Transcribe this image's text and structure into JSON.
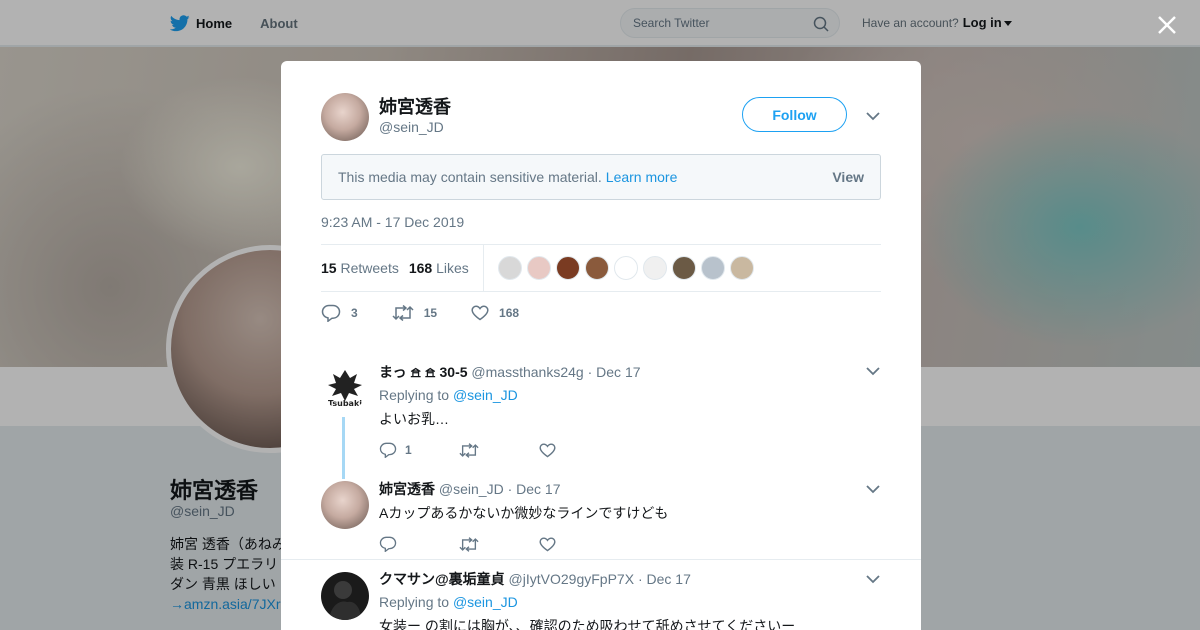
{
  "nav": {
    "home_label": "Home",
    "about_label": "About",
    "search_placeholder": "Search Twitter",
    "account_prompt": "Have an account?",
    "login_label": "Log in"
  },
  "profile": {
    "name": "姉宮透香",
    "handle": "@sein_JD",
    "bio_line1": "姉宮 透香（あねみ",
    "bio_line2": "装 R-15 プエラリ",
    "bio_line3": "ダン 青黒 ほしい",
    "bio_link": "→amzn.asia/7JXr"
  },
  "tweet": {
    "name": "姉宮透香",
    "handle": "@sein_JD",
    "follow_label": "Follow",
    "sensitive_text": "This media may contain sensitive material.",
    "learn_more": "Learn more",
    "view_label": "View",
    "timestamp": "9:23 AM - 17 Dec 2019",
    "retweets_count": "15",
    "retweets_label": "Retweets",
    "likes_count": "168",
    "likes_label": "Likes",
    "reply_count": "3",
    "retweet_count": "15",
    "like_count": "168"
  },
  "likers": [
    "#d8d8d8",
    "#e8c9c4",
    "#7a3b22",
    "#8a5a3c",
    "#ffffff",
    "#f0f0f0",
    "#6b5a45",
    "#b8c2cc",
    "#c9b8a0"
  ],
  "replies": [
    {
      "name": "まっ 𖠿 𖠿 30-5",
      "handle": "@massthanks24g",
      "date": "Dec 17",
      "replying_prefix": "Replying to",
      "replying_to": "@sein_JD",
      "text": "よいお乳…",
      "reply_count": "1"
    },
    {
      "name": "姉宮透香",
      "handle": "@sein_JD",
      "date": "Dec 17",
      "text": "Aカップあるかないか微妙なラインですけども"
    },
    {
      "name": "クマサン@裏垢童貞",
      "handle": "@jIytVO29gyFpP7X",
      "date": "Dec 17",
      "replying_prefix": "Replying to",
      "replying_to": "@sein_JD",
      "text": "女装ー の割には胸が、、確認のため吸わせて舐めさせてくださいー"
    }
  ],
  "colors": {
    "twitter_blue": "#1da1f2",
    "link_blue": "#1b95e0",
    "gray_text": "#657786"
  }
}
